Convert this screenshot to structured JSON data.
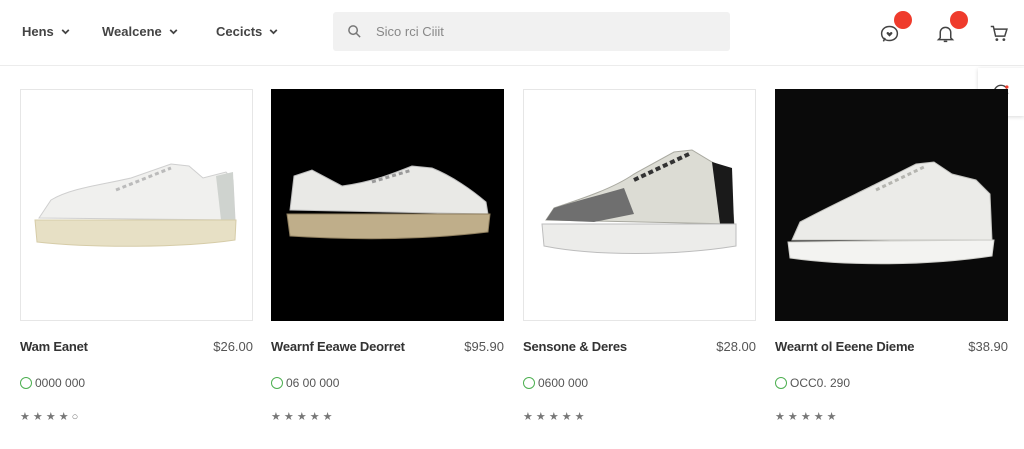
{
  "nav": {
    "items": [
      {
        "label": "Hens"
      },
      {
        "label": "Wealcene"
      },
      {
        "label": "Cecicts"
      }
    ]
  },
  "search": {
    "placeholder": "Sico rci Ciiit"
  },
  "header_icons": {
    "chat_badge": "",
    "bell_badge": ""
  },
  "products": [
    {
      "name": "Wam Eanet",
      "price": "$26.00",
      "variant": "0000 000",
      "rating_display": "★ ★ ★ ★ ○",
      "image_bg": "light"
    },
    {
      "name": "Wearnf Eeawe Deorret",
      "price": "$95.90",
      "variant": "06 00 000",
      "rating_display": "★ ★ ★ ★ ★",
      "image_bg": "dark"
    },
    {
      "name": "Sensone & Deres",
      "price": "$28.00",
      "variant": "0600 000",
      "rating_display": "★ ★ ★ ★ ★",
      "image_bg": "light"
    },
    {
      "name": "Wearnt ol Eeene Dieme",
      "price": "$38.90",
      "variant": "OCC0. 290",
      "rating_display": "★ ★ ★ ★ ★",
      "image_bg": "dark"
    }
  ],
  "colors": {
    "badge": "#ef3b2c",
    "variant_dot": "#4caf50",
    "search_bg": "#f1f1f1"
  }
}
